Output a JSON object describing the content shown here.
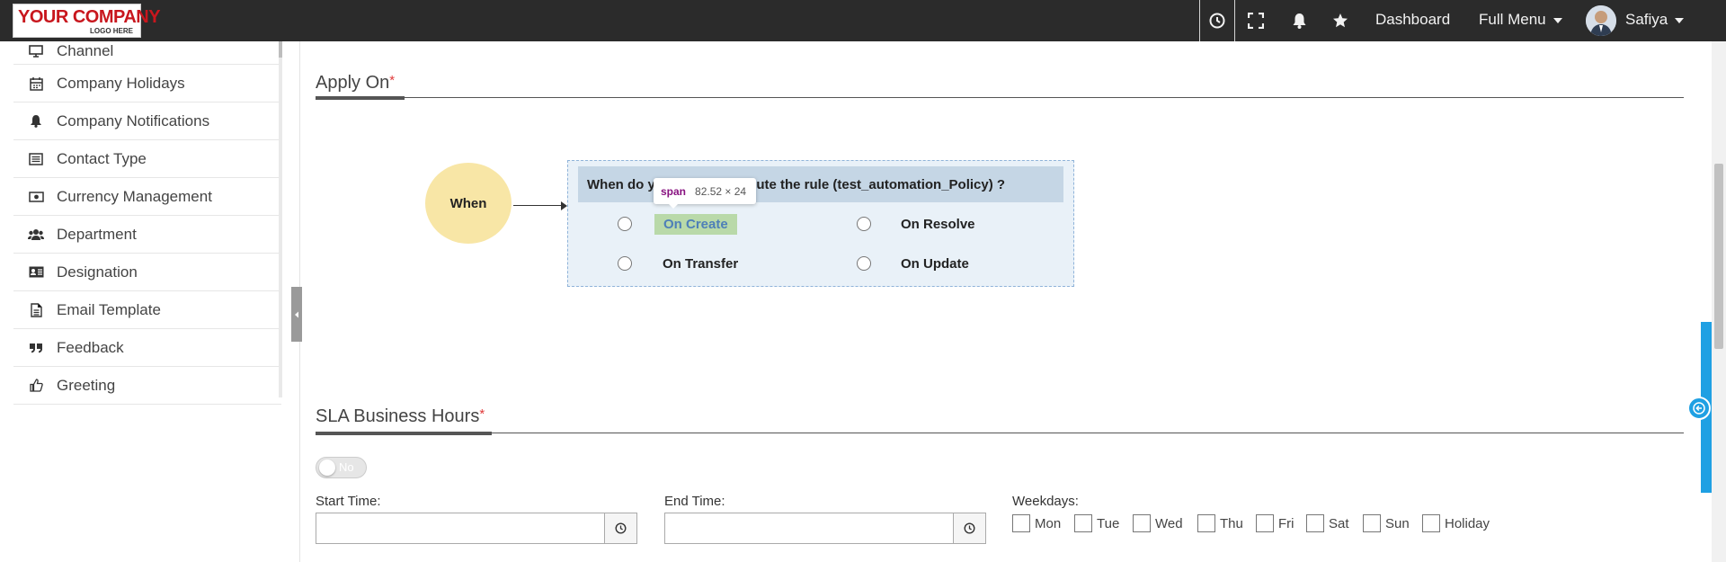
{
  "topbar": {
    "logo_main": "YOUR COMPANY",
    "logo_sub": "LOGO HERE",
    "dashboard_label": "Dashboard",
    "full_menu_label": "Full Menu",
    "user_name": "Safiya"
  },
  "sidebar": {
    "items": [
      {
        "label": "Channel",
        "icon": "monitor-icon"
      },
      {
        "label": "Company Holidays",
        "icon": "calendar-icon"
      },
      {
        "label": "Company Notifications",
        "icon": "bell-icon"
      },
      {
        "label": "Contact Type",
        "icon": "list-icon"
      },
      {
        "label": "Currency Management",
        "icon": "money-icon"
      },
      {
        "label": "Department",
        "icon": "users-icon"
      },
      {
        "label": "Designation",
        "icon": "id-card-icon"
      },
      {
        "label": "Email Template",
        "icon": "file-icon"
      },
      {
        "label": "Feedback",
        "icon": "quote-icon"
      },
      {
        "label": "Greeting",
        "icon": "thumbs-up-icon"
      }
    ]
  },
  "apply_on": {
    "title": "Apply On",
    "required_mark": "*",
    "when_label": "When",
    "question": "When do you want to execute the rule (test_automation_Policy) ?",
    "options": [
      "On Create",
      "On Resolve",
      "On Transfer",
      "On Update"
    ]
  },
  "tooltip": {
    "tag": "span",
    "size": "82.52 × 24"
  },
  "sla": {
    "title": "SLA Business Hours",
    "required_mark": "*",
    "toggle_label": "No",
    "start_time_label": "Start Time:",
    "end_time_label": "End Time:",
    "weekdays_label": "Weekdays:",
    "weekdays": [
      "Mon",
      "Tue",
      "Wed",
      "Thu",
      "Fri",
      "Sat",
      "Sun",
      "Holiday"
    ]
  },
  "colors": {
    "topbar": "#2b2b2b",
    "when_circle": "#f8e6a6",
    "rule_box": "#e9f1f8",
    "accent_blue": "#1fa0e3",
    "required": "#e03a3a"
  }
}
